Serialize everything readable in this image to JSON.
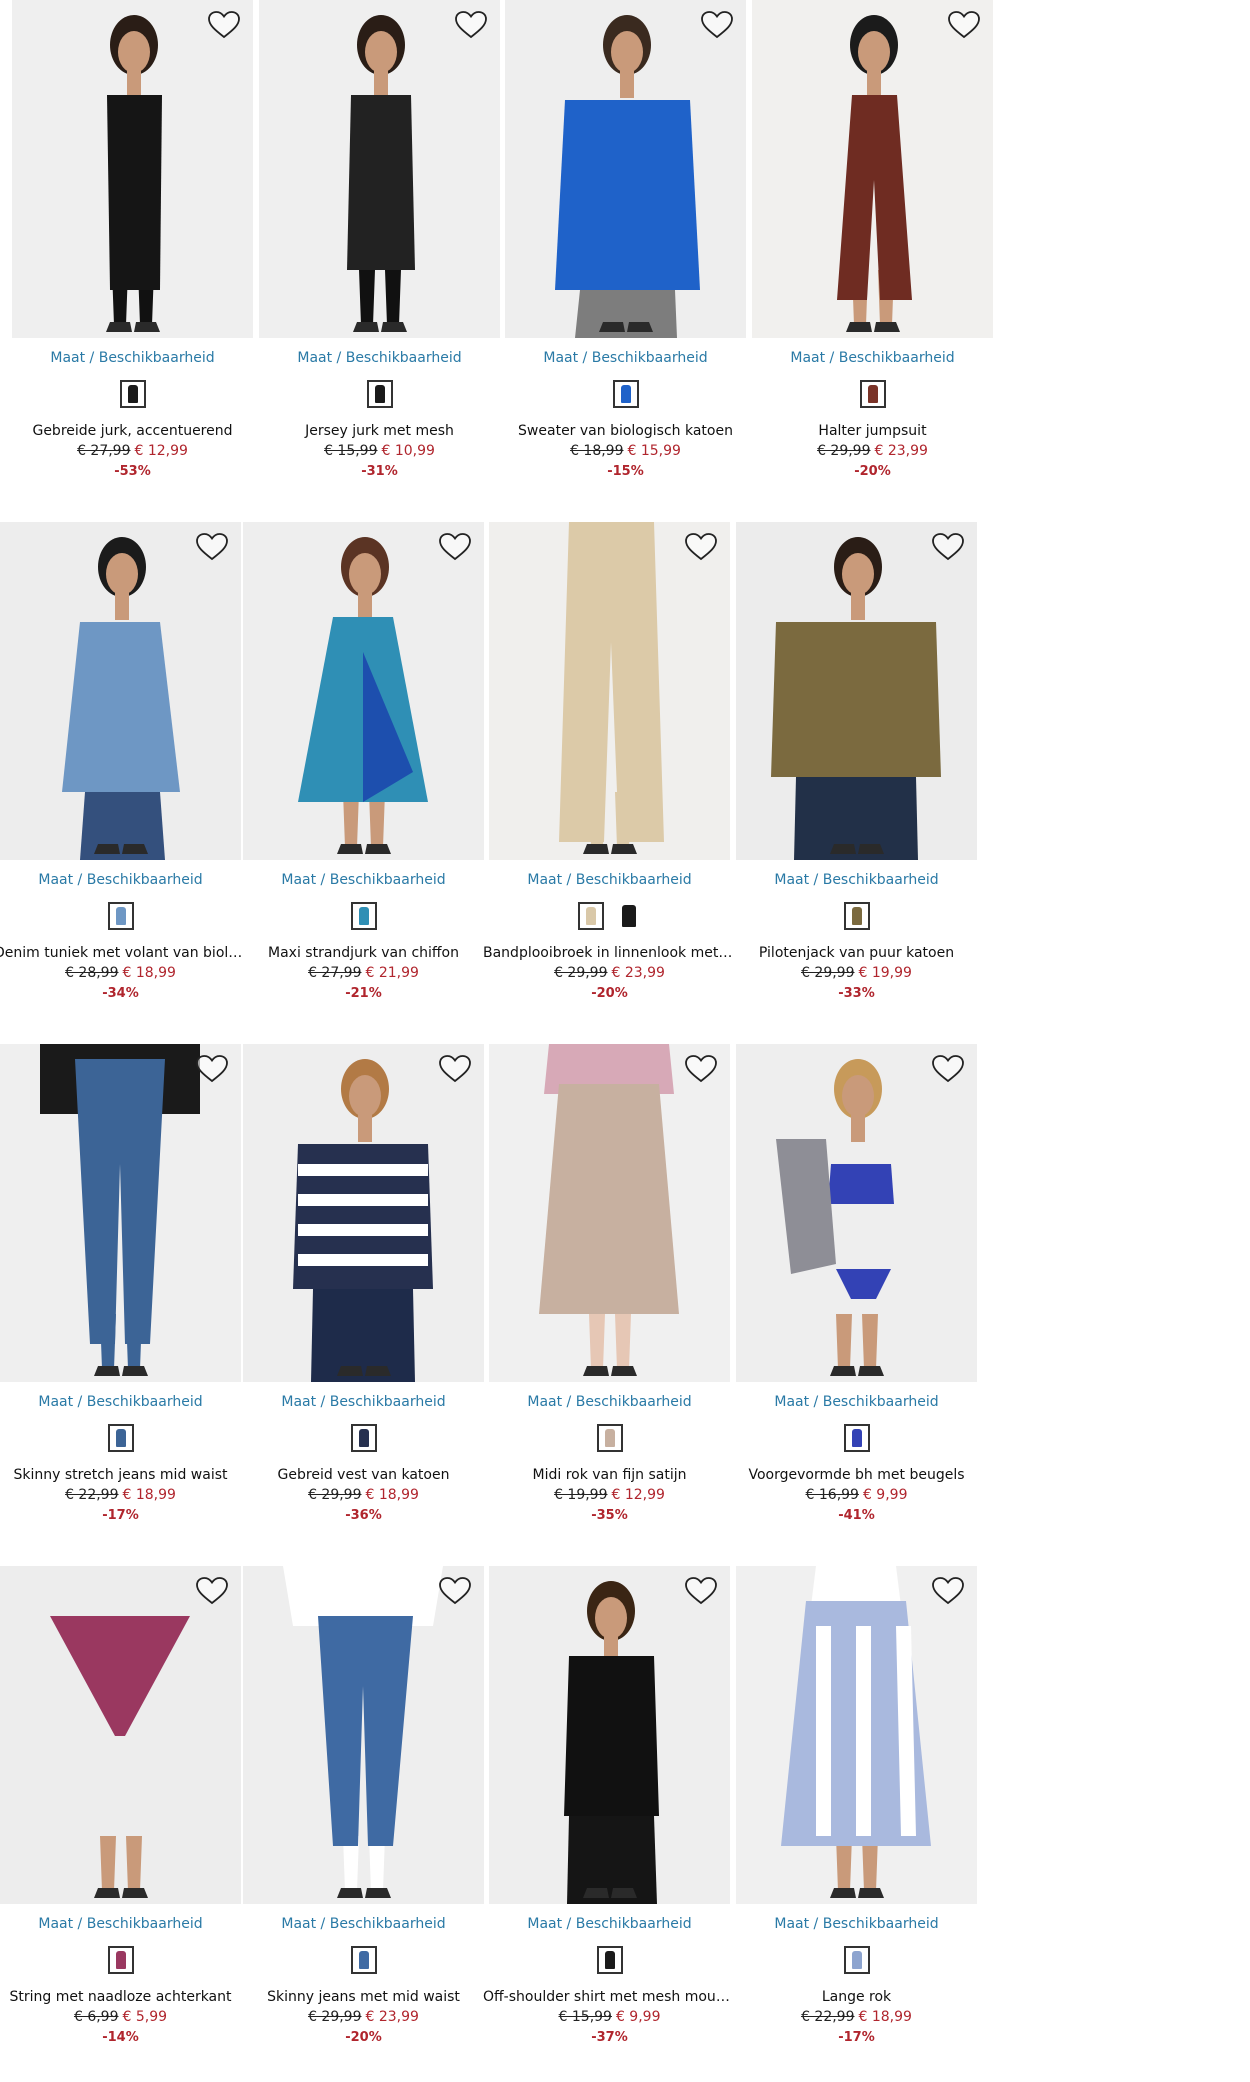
{
  "size_link_label": "Maat / Beschikbaarheid",
  "products": [
    {
      "name": "Gebreide jurk, accentuerend",
      "old_price": "€ 27,99",
      "new_price": "€ 12,99",
      "discount": "-53%",
      "image": "model-black-knit-dress",
      "swatches": [
        {
          "color": "#1a1a1a",
          "selected": true
        }
      ],
      "bg": "#efefef"
    },
    {
      "name": "Jersey jurk met mesh",
      "old_price": "€ 15,99",
      "new_price": "€ 10,99",
      "discount": "-31%",
      "image": "model-black-mesh-dress",
      "swatches": [
        {
          "color": "#1a1a1a",
          "selected": true
        }
      ],
      "bg": "#efefef"
    },
    {
      "name": "Sweater van biologisch katoen",
      "old_price": "€ 18,99",
      "new_price": "€ 15,99",
      "discount": "-15%",
      "image": "model-blue-chicago-sweater",
      "swatches": [
        {
          "color": "#1f62c9",
          "selected": true
        }
      ],
      "bg": "#eeeeee"
    },
    {
      "name": "Halter jumpsuit",
      "old_price": "€ 29,99",
      "new_price": "€ 23,99",
      "discount": "-20%",
      "image": "model-brown-leaf-jumpsuit",
      "swatches": [
        {
          "color": "#7a3328",
          "selected": true
        }
      ],
      "bg": "#f1f0ee"
    },
    {
      "name": "Denim tuniek met volant van biologisch katoen",
      "old_price": "€ 28,99",
      "new_price": "€ 18,99",
      "discount": "-34%",
      "image": "model-denim-tunic",
      "swatches": [
        {
          "color": "#6e97c4",
          "selected": true
        }
      ],
      "bg": "#ededed"
    },
    {
      "name": "Maxi strandjurk van chiffon",
      "old_price": "€ 27,99",
      "new_price": "€ 21,99",
      "discount": "-21%",
      "image": "model-blue-print-beach-dress",
      "swatches": [
        {
          "color": "#2f8fb5",
          "selected": true
        }
      ],
      "bg": "#eeeeee"
    },
    {
      "name": "Bandplooibroek in linnenlook met elastische band",
      "old_price": "€ 29,99",
      "new_price": "€ 23,99",
      "discount": "-20%",
      "image": "model-beige-wide-trousers",
      "swatches": [
        {
          "color": "#d9c8a8",
          "selected": true
        },
        {
          "color": "#1a1a1a",
          "selected": false
        }
      ],
      "bg": "#f0efed"
    },
    {
      "name": "Pilotenjack van puur katoen",
      "old_price": "€ 29,99",
      "new_price": "€ 19,99",
      "discount": "-33%",
      "image": "model-khaki-jacket",
      "swatches": [
        {
          "color": "#7b6a3f",
          "selected": true
        }
      ],
      "bg": "#ececec"
    },
    {
      "name": "Skinny stretch jeans mid waist",
      "old_price": "€ 22,99",
      "new_price": "€ 18,99",
      "discount": "-17%",
      "image": "model-skinny-jeans",
      "swatches": [
        {
          "color": "#3c6496",
          "selected": true
        }
      ],
      "bg": "#efefef"
    },
    {
      "name": "Gebreid vest van katoen",
      "old_price": "€ 29,99",
      "new_price": "€ 18,99",
      "discount": "-36%",
      "image": "model-striped-cardigan",
      "swatches": [
        {
          "color": "#26304f",
          "selected": true
        }
      ],
      "bg": "#eeeeee"
    },
    {
      "name": "Midi rok van fijn satijn",
      "old_price": "€ 19,99",
      "new_price": "€ 12,99",
      "discount": "-35%",
      "image": "model-satin-midi-skirt",
      "swatches": [
        {
          "color": "#c7b0a0",
          "selected": true
        }
      ],
      "bg": "#f0f0f0"
    },
    {
      "name": "Voorgevormde bh met beugels",
      "old_price": "€ 16,99",
      "new_price": "€ 9,99",
      "discount": "-41%",
      "image": "model-blue-bra",
      "swatches": [
        {
          "color": "#3342b5",
          "selected": true
        }
      ],
      "bg": "#eeeeee"
    },
    {
      "name": "String met naadloze achterkant",
      "old_price": "€ 6,99",
      "new_price": "€ 5,99",
      "discount": "-14%",
      "image": "model-pink-string",
      "swatches": [
        {
          "color": "#9a3860",
          "selected": true
        }
      ],
      "bg": "#ededed"
    },
    {
      "name": "Skinny jeans met mid waist",
      "old_price": "€ 29,99",
      "new_price": "€ 23,99",
      "discount": "-20%",
      "image": "model-embroidered-jeans",
      "swatches": [
        {
          "color": "#3f6aa3",
          "selected": true
        }
      ],
      "bg": "#eeeeee"
    },
    {
      "name": "Off-shoulder shirt met mesh mouwen",
      "old_price": "€ 15,99",
      "new_price": "€ 9,99",
      "discount": "-37%",
      "image": "model-black-offshoulder-shirt",
      "swatches": [
        {
          "color": "#1a1a1a",
          "selected": true
        }
      ],
      "bg": "#eeeeee"
    },
    {
      "name": "Lange rok",
      "old_price": "€ 22,99",
      "new_price": "€ 18,99",
      "discount": "-17%",
      "image": "model-paisley-long-skirt",
      "swatches": [
        {
          "color": "#8da4cf",
          "selected": true
        }
      ],
      "bg": "#f0f0f0"
    }
  ]
}
